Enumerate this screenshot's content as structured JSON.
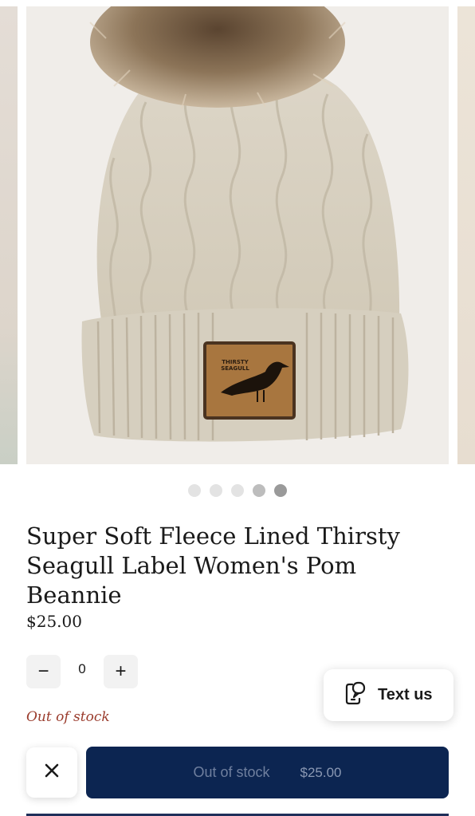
{
  "gallery": {
    "image_alt": "Cream cable knit beanie with fur pom and Thirsty Seagull leather label",
    "label_text": "THIRSTY SEAGULL",
    "dots_count": 5,
    "active_dot": 4
  },
  "product": {
    "title": "Super Soft Fleece Lined Thirsty Seagull Label Women's Pom Beannie",
    "price": "$25.00"
  },
  "quantity": {
    "minus_label": "−",
    "value": "0",
    "plus_label": "+"
  },
  "stock_status": "Out of stock",
  "chat_widget": {
    "label": "Text us",
    "icon": "text-message-icon"
  },
  "purchase_bar": {
    "close_icon": "close-icon",
    "button_label": "Out of stock",
    "button_price": "$25.00"
  },
  "colors": {
    "buy_bar": "#0c2551",
    "stock_text": "#9a3b2c",
    "beanie": "#d8d1c2"
  }
}
